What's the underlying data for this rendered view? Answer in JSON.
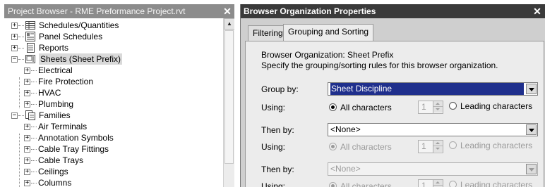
{
  "browser": {
    "title": "Project Browser - RME Preformance Project.rvt",
    "close": "✕",
    "tree": [
      {
        "label": "Schedules/Quantities",
        "icon": "schedule-icon",
        "expander": "+"
      },
      {
        "label": "Panel Schedules",
        "icon": "panel-schedule-icon",
        "expander": "+"
      },
      {
        "label": "Reports",
        "icon": "report-icon",
        "expander": "+"
      },
      {
        "label": "Sheets (Sheet Prefix)",
        "icon": "sheet-icon",
        "expander": "−",
        "selected": true
      },
      {
        "label": "Electrical",
        "expander": "+"
      },
      {
        "label": "Fire Protection",
        "expander": "+"
      },
      {
        "label": "HVAC",
        "expander": "+"
      },
      {
        "label": "Plumbing",
        "expander": "+"
      },
      {
        "label": "Families",
        "icon": "family-icon",
        "expander": "−"
      },
      {
        "label": "Air Terminals",
        "expander": "+"
      },
      {
        "label": "Annotation Symbols",
        "expander": "+"
      },
      {
        "label": "Cable Tray Fittings",
        "expander": "+"
      },
      {
        "label": "Cable Trays",
        "expander": "+"
      },
      {
        "label": "Ceilings",
        "expander": "+"
      },
      {
        "label": "Columns",
        "expander": "+"
      }
    ],
    "scroll_up": "▲"
  },
  "dialog": {
    "title": "Browser Organization Properties",
    "close": "✕",
    "tabs": [
      "Filtering",
      "Grouping and Sorting"
    ],
    "active_tab": "Grouping and Sorting",
    "info_line1": "Browser Organization: Sheet Prefix",
    "info_line2": "Specify the grouping/sorting rules for this browser organization.",
    "group_by_label": "Group by:",
    "group_by_value": "Sheet Discipline",
    "using_label": "Using:",
    "all_characters": "All characters",
    "leading_characters": "Leading characters",
    "spin_value": "1",
    "then_by_label": "Then by:",
    "then_by_value": "<None>",
    "then_by2_value": "<None>"
  },
  "colors": {
    "selection": "#1f2f8c",
    "dialog_title_bg": "#3a3a3a",
    "browser_title_bg": "#8c8c8c"
  }
}
